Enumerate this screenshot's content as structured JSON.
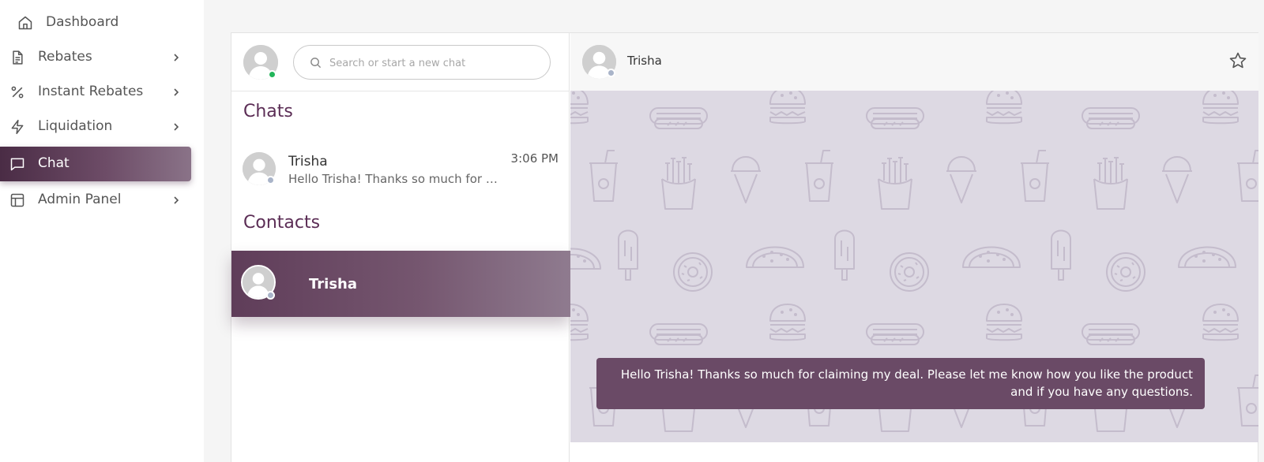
{
  "nav": {
    "items": [
      {
        "label": "Dashboard",
        "icon": "home-icon",
        "has_submenu": false,
        "active": false
      },
      {
        "label": "Rebates",
        "icon": "document-icon",
        "has_submenu": true,
        "active": false
      },
      {
        "label": "Instant Rebates",
        "icon": "percent-icon",
        "has_submenu": true,
        "active": false
      },
      {
        "label": "Liquidation",
        "icon": "lightning-icon",
        "has_submenu": true,
        "active": false
      },
      {
        "label": "Chat",
        "icon": "chat-bubble-icon",
        "has_submenu": false,
        "active": true
      },
      {
        "label": "Admin Panel",
        "icon": "layout-icon",
        "has_submenu": true,
        "active": false
      }
    ]
  },
  "contacts_pane": {
    "search": {
      "placeholder": "Search or start a new chat",
      "value": ""
    },
    "chats_title": "Chats",
    "contacts_title": "Contacts",
    "chats": [
      {
        "name": "Trisha",
        "preview": "Hello Trisha! Thanks so much for claiming my deal. Please let me know how you like the product and if you have any questions.",
        "time": "3:06 PM"
      }
    ],
    "contacts": [
      {
        "name": "Trisha",
        "selected": true
      }
    ]
  },
  "conversation": {
    "contact_name": "Trisha",
    "messages": [
      {
        "text": "Hello Trisha! Thanks so much for claiming my deal. Please let me know how you like the product and if you have any questions.",
        "from_me": true
      }
    ]
  },
  "colors": {
    "accent": "#5b2d55",
    "active_gradient_start": "#4a2c45",
    "bubble": "#6a4a66",
    "online_status": "#22b55a",
    "offline_status": "#a9b4c9",
    "chat_background": "#ddd9e3"
  }
}
